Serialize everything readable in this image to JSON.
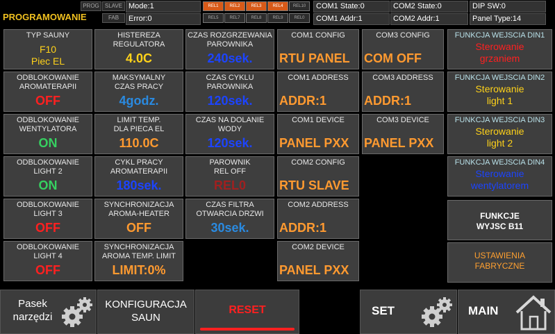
{
  "colors": {
    "orange": "#ff9a30",
    "yellow": "#ffd21a",
    "red": "#ff2020",
    "green": "#36d060",
    "blue": "#1c44ff",
    "lightblue": "#2a8ae0",
    "darkred": "#a02020"
  },
  "header": {
    "title": "PROGRAMOWANIE",
    "tag_prog": "PROG",
    "tag_slave": "SLAVE",
    "tag_fab": "FAB",
    "mode": "Mode:1",
    "error": "Error:0",
    "relays": [
      {
        "label": "REL1",
        "on": true
      },
      {
        "label": "REL2",
        "on": true
      },
      {
        "label": "REL3",
        "on": true
      },
      {
        "label": "REL4",
        "on": true
      },
      {
        "label": "REL10",
        "on": false
      },
      {
        "label": "REL5",
        "on": false
      },
      {
        "label": "REL7",
        "on": false
      },
      {
        "label": "REL8",
        "on": false
      },
      {
        "label": "REL9",
        "on": false
      },
      {
        "label": "REL0",
        "on": false
      }
    ],
    "com1_state": "COM1 State:0",
    "com1_addr": "COM1 Addr:1",
    "com2_state": "COM2 State:0",
    "com2_addr": "COM2 Addr:1",
    "dip_sw": "DIP SW:0",
    "panel_type": "Panel Type:14"
  },
  "col1": [
    {
      "label": "TYP SAUNY",
      "value": "F10\nPiec EL",
      "color": "yellow",
      "small": true
    },
    {
      "label": "ODBLOKOWANIE\nAROMATERAPII",
      "value": "OFF",
      "color": "red"
    },
    {
      "label": "ODBLOKOWANIE\nWENTYLATORA",
      "value": "ON",
      "color": "green"
    },
    {
      "label": "ODBLOKOWANIE\nLIGHT 2",
      "value": "ON",
      "color": "green"
    },
    {
      "label": "ODBLOKOWANIE\nLIGHT 3",
      "value": "OFF",
      "color": "red"
    },
    {
      "label": "ODBLOKOWANIE\nLIGHT 4",
      "value": "OFF",
      "color": "red"
    }
  ],
  "col2": [
    {
      "label": "HISTEREZA\nREGULATORA",
      "value": "4.0C",
      "color": "yellow"
    },
    {
      "label": "MAKSYMALNY\nCZAS PRACY",
      "value": "4godz.",
      "color": "lightblue"
    },
    {
      "label": "LIMIT TEMP.\nDLA PIECA EL",
      "value": "110.0C",
      "color": "orange"
    },
    {
      "label": "CYKL PRACY\nAROMATERAPII",
      "value": "180sek.",
      "color": "blue"
    },
    {
      "label": "SYNCHRONIZACJA\nAROMA-HEATER",
      "value": "OFF",
      "color": "orange"
    },
    {
      "label": "SYNCHRONIZACJA\nAROMA TEMP. LIMIT",
      "value": "LIMIT:0%",
      "color": "orange"
    }
  ],
  "col3": [
    {
      "label": "CZAS ROZGRZEWANIA\nPAROWNIKA",
      "value": "240sek.",
      "color": "blue"
    },
    {
      "label": "CZAS CYKLU\nPAROWNIKA",
      "value": "120sek.",
      "color": "blue"
    },
    {
      "label": "CZAS NA DOLANIE\nWODY",
      "value": "120sek.",
      "color": "blue"
    },
    {
      "label": "PAROWNIK\nREL OFF",
      "value": "REL0",
      "color": "darkred"
    },
    {
      "label": "CZAS FILTRA\nOTWARCIA DRZWI",
      "value": "30sek.",
      "color": "lightblue"
    }
  ],
  "com_a": [
    {
      "label": "COM1 CONFIG",
      "value": "RTU PANEL"
    },
    {
      "label": "COM1 ADDRESS",
      "value": "ADDR:1"
    },
    {
      "label": "COM1 DEVICE",
      "value": "PANEL PXX"
    },
    {
      "label": "COM2 CONFIG",
      "value": "RTU SLAVE"
    },
    {
      "label": "COM2 ADDRESS",
      "value": "ADDR:1"
    },
    {
      "label": "COM2 DEVICE",
      "value": "PANEL PXX"
    }
  ],
  "com_b": [
    {
      "label": "COM3 CONFIG",
      "value": "COM OFF"
    },
    {
      "label": "COM3 ADDRESS",
      "value": "ADDR:1"
    },
    {
      "label": "COM3 DEVICE",
      "value": "PANEL PXX"
    }
  ],
  "din": [
    {
      "label": "FUNKCJA WEJSCIA DIN1",
      "value": "Sterowanie\ngrzaniem",
      "color": "red"
    },
    {
      "label": "FUNKCJA WEJSCIA DIN2",
      "value": "Sterowanie\nlight 1",
      "color": "yellow"
    },
    {
      "label": "FUNKCJA WEJSCIA DIN3",
      "value": "Sterowanie\nlight 2",
      "color": "yellow"
    },
    {
      "label": "FUNKCJA WEJSCIA DIN4",
      "value": "Sterowanie\nwentylatorem",
      "color": "blue"
    }
  ],
  "funkcje_b11": "FUNKCJE\nWYJSC B11",
  "ustawienia": "USTAWIENIA\nFABRYCZNE",
  "bottom": {
    "pasek": "Pasek\nnarzędzi",
    "konfiguracja": "KONFIGURACJA\nSAUN",
    "reset": "RESET",
    "set": "SET",
    "main": "MAIN"
  }
}
